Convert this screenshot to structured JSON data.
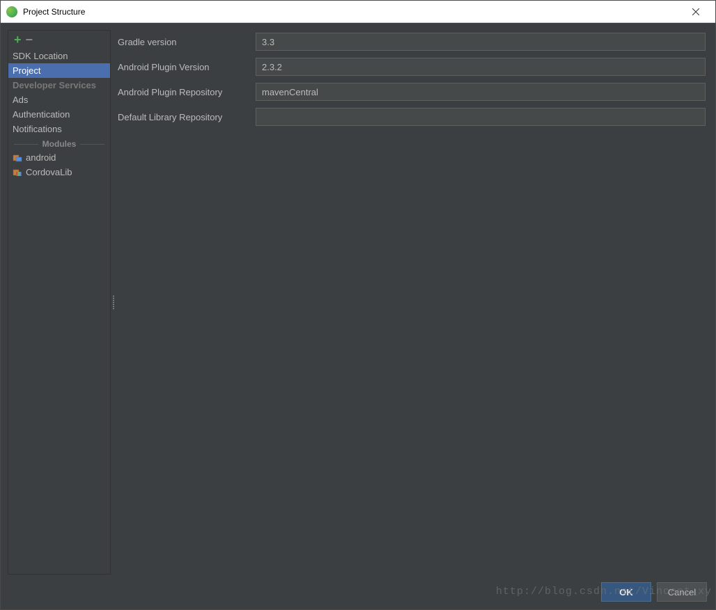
{
  "window": {
    "title": "Project Structure"
  },
  "sidebar": {
    "sdk_location": "SDK Location",
    "project": "Project",
    "developer_services": "Developer Services",
    "ads": "Ads",
    "authentication": "Authentication",
    "notifications": "Notifications",
    "modules_header": "Modules",
    "module_android": "android",
    "module_cordovalib": "CordovaLib"
  },
  "form": {
    "gradle_version_label": "Gradle version",
    "gradle_version_value": "3.3",
    "android_plugin_version_label": "Android Plugin Version",
    "android_plugin_version_value": "2.3.2",
    "android_plugin_repo_label": "Android Plugin Repository",
    "android_plugin_repo_value": "mavenCentral",
    "default_library_repo_label": "Default Library Repository",
    "default_library_repo_value": ""
  },
  "footer": {
    "ok": "OK",
    "cancel": "Cancel"
  },
  "watermark": "http://blog.csdn.net/Vincent_xy"
}
